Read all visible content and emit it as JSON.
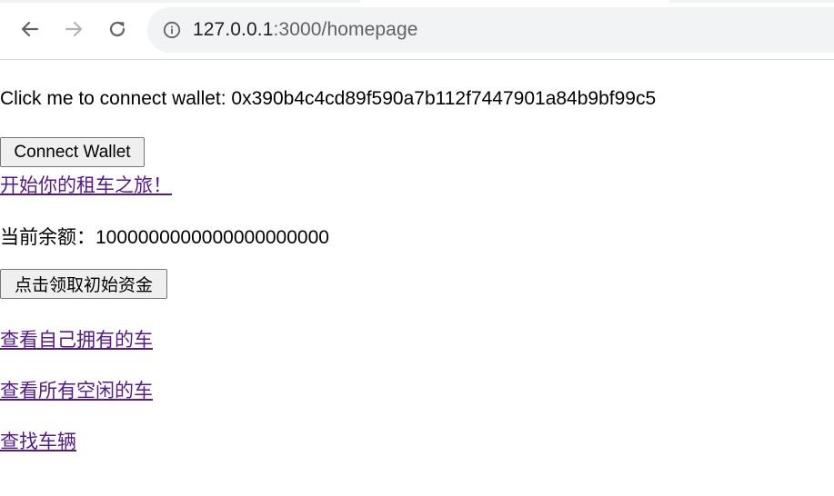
{
  "browser": {
    "url_host": "127.0.0.1",
    "url_rest": ":3000/homepage",
    "back_icon": "back-arrow-icon",
    "forward_icon": "forward-arrow-icon",
    "reload_icon": "reload-icon",
    "site_info_icon": "info-icon"
  },
  "page": {
    "wallet_text": "Click me to connect wallet: 0x390b4c4cd89f590a7b112f7447901a84b9bf99c5",
    "connect_button": "Connect Wallet",
    "start_link": "开始你的租车之旅！",
    "balance_text": "当前余额：1000000000000000000000",
    "claim_button": "点击领取初始资金",
    "own_cars_link": "查看自己拥有的车",
    "idle_cars_link": "查看所有空闲的车",
    "search_link": "查找车辆"
  },
  "colors": {
    "link_visited": "#551a8b",
    "omnibox_bg": "#f1f3f4",
    "button_bg": "#efefef"
  }
}
